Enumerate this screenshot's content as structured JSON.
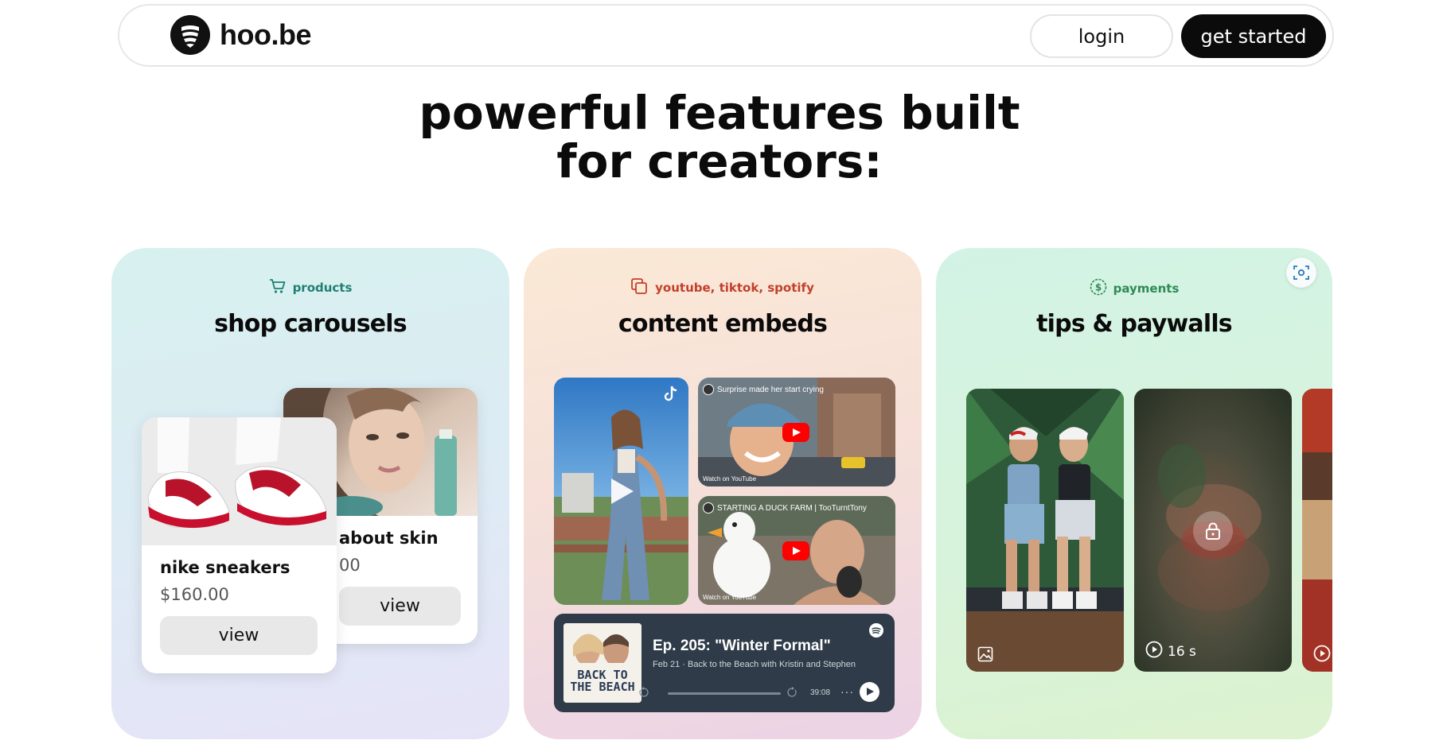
{
  "nav": {
    "logo_text": "hoo.be",
    "login_label": "login",
    "get_started_label": "get started"
  },
  "hero": {
    "line1": "powerful features built",
    "line2": "for creators:"
  },
  "cards": [
    {
      "eyebrow": "products",
      "title": "shop carousels",
      "accent": "#1f7f73",
      "products": [
        {
          "name": "about skin",
          "price": "00",
          "button": "view"
        },
        {
          "name": "nike sneakers",
          "price": "$160.00",
          "button": "view"
        }
      ]
    },
    {
      "eyebrow": "youtube, tiktok, spotify",
      "title": "content embeds",
      "accent": "#c2402b",
      "youtube": [
        {
          "caption": "Surprise made her start crying",
          "watch": "Watch on YouTube"
        },
        {
          "caption": "STARTING A DUCK FARM | TooTurntTony",
          "watch": "Watch on YouTube"
        }
      ],
      "spotify": {
        "title": "Ep. 205: \"Winter Formal\"",
        "meta": "Feb 21 · Back to the Beach with Kristin and Stephen",
        "duration": "39:08",
        "cover_text_1": "BACK TO",
        "cover_text_2": "THE BEACH"
      }
    },
    {
      "eyebrow": "payments",
      "title": "tips & paywalls",
      "accent": "#2f8a55",
      "video_length": "16 s"
    }
  ],
  "icons": [
    "logo-icon",
    "cart-icon",
    "embeds-icon",
    "dollar-icon",
    "scan-icon",
    "tiktok-icon",
    "play-icon",
    "lock-icon",
    "image-icon",
    "video-icon",
    "spotify-icon"
  ]
}
